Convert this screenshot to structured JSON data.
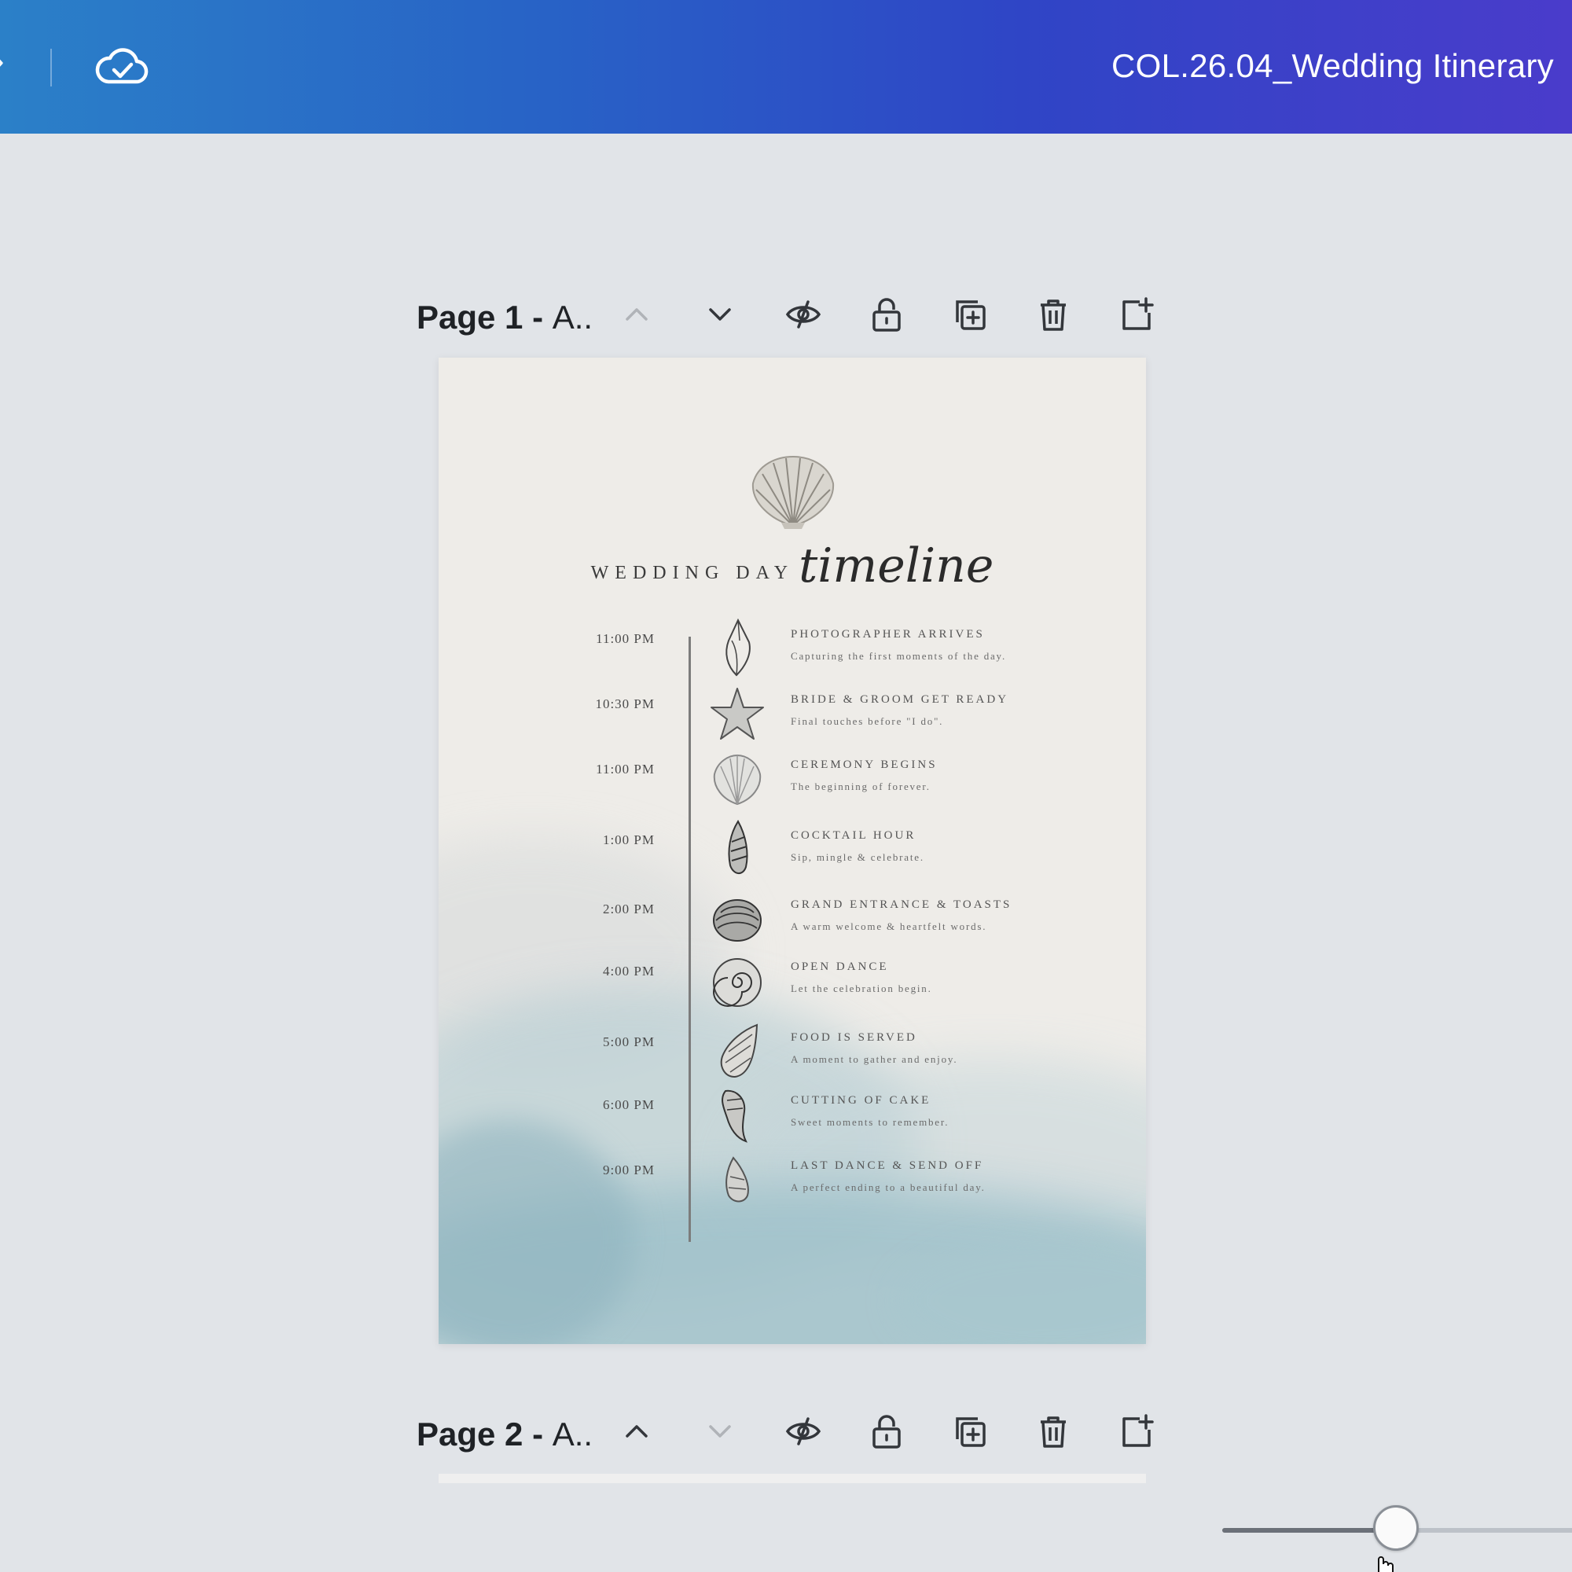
{
  "topbar": {
    "document_title": "COL.26.04_Wedding Itinerary",
    "sync_status_icon": "cloud-check-icon"
  },
  "page_toolbars": [
    {
      "label_bold": "Page 1 - ",
      "label_rest": "A..",
      "up_enabled": false,
      "down_enabled": true
    },
    {
      "label_bold": "Page 2 - ",
      "label_rest": "A..",
      "up_enabled": true,
      "down_enabled": false
    }
  ],
  "toolbar_icons": [
    "chevron-up-icon",
    "chevron-down-icon",
    "hide-eye-icon",
    "lock-icon",
    "duplicate-page-icon",
    "trash-icon",
    "add-page-icon"
  ],
  "document": {
    "heading_caps": "WEDDING DAY",
    "heading_script": "timeline",
    "events": [
      {
        "time": "11:00 PM",
        "title": "PHOTOGRAPHER ARRIVES",
        "subtitle": "Capturing the first moments of the day.",
        "icon": "conch-shell-icon"
      },
      {
        "time": "10:30 PM",
        "title": "BRIDE & GROOM GET READY",
        "subtitle": "Final touches before \"I do\".",
        "icon": "starfish-icon"
      },
      {
        "time": "11:00 PM",
        "title": "CEREMONY BEGINS",
        "subtitle": "The beginning of forever.",
        "icon": "scallop-shell-icon"
      },
      {
        "time": "1:00 PM",
        "title": "COCKTAIL HOUR",
        "subtitle": "Sip, mingle & celebrate.",
        "icon": "spiral-shell-icon"
      },
      {
        "time": "2:00 PM",
        "title": "GRAND ENTRANCE & TOASTS",
        "subtitle": "A warm welcome & heartfelt words.",
        "icon": "clam-shell-icon"
      },
      {
        "time": "4:00 PM",
        "title": "OPEN DANCE",
        "subtitle": "Let the celebration begin.",
        "icon": "nautilus-shell-icon"
      },
      {
        "time": "5:00 PM",
        "title": "FOOD IS SERVED",
        "subtitle": "A moment to gather and enjoy.",
        "icon": "whelk-shell-icon"
      },
      {
        "time": "6:00 PM",
        "title": "CUTTING OF CAKE",
        "subtitle": "Sweet moments to remember.",
        "icon": "murex-shell-icon"
      },
      {
        "time": "9:00 PM",
        "title": "LAST DANCE & SEND OFF",
        "subtitle": "A perfect ending to a beautiful day.",
        "icon": "small-shell-icon"
      }
    ]
  },
  "zoom": {
    "level_fraction": 0.48
  },
  "colors": {
    "topbar_start": "#2b80c8",
    "topbar_end": "#4a3ccb",
    "workspace": "#e1e4e8",
    "wash": "#a9c6cf"
  }
}
